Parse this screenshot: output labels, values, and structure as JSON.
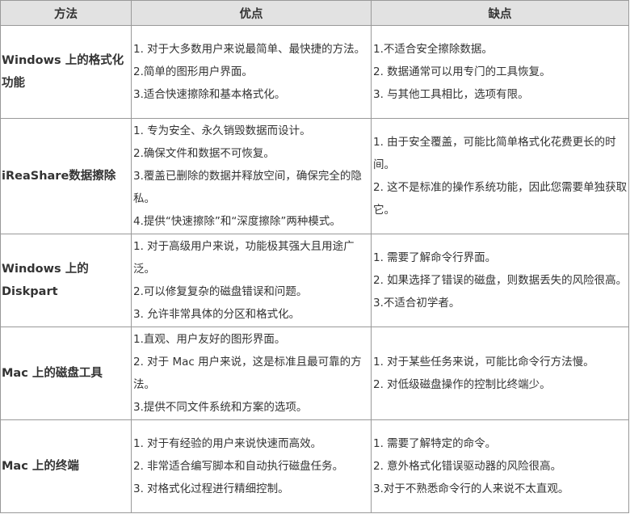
{
  "table": {
    "headers": {
      "method": "方法",
      "pros": "优点",
      "cons": "缺点"
    },
    "rows": [
      {
        "method": "Windows 上的格式化功能",
        "pros": [
          "1. 对于大多数用户来说最简单、最快捷的方法。",
          "2.简单的图形用户界面。",
          "3.适合快速擦除和基本格式化。"
        ],
        "cons": [
          "1.不适合安全擦除数据。",
          "2. 数据通常可以用专门的工具恢复。",
          "3. 与其他工具相比，选项有限。"
        ]
      },
      {
        "method": "iReaShare数据擦除",
        "pros": [
          "1. 专为安全、永久销毁数据而设计。",
          "2.确保文件和数据不可恢复。",
          "3.覆盖已删除的数据并释放空间，确保完全的隐私。",
          "4.提供“快速擦除”和“深度擦除”两种模式。"
        ],
        "cons": [
          "1. 由于安全覆盖，可能比简单格式化花费更长的时间。",
          "2. 这不是标准的操作系统功能，因此您需要单独获取它。"
        ]
      },
      {
        "method": "Windows 上的 Diskpart",
        "pros": [
          "1. 对于高级用户来说，功能极其强大且用途广泛。",
          "2.可以修复复杂的磁盘错误和问题。",
          "3. 允许非常具体的分区和格式化。"
        ],
        "cons": [
          "1. 需要了解命令行界面。",
          "2. 如果选择了错误的磁盘，则数据丢失的风险很高。",
          "3.不适合初学者。"
        ]
      },
      {
        "method": "Mac 上的磁盘工具",
        "pros": [
          "1.直观、用户友好的图形界面。",
          "2. 对于 Mac 用户来说，这是标准且最可靠的方法。",
          "3.提供不同文件系统和方案的选项。"
        ],
        "cons": [
          "1. 对于某些任务来说，可能比命令行方法慢。",
          "2. 对低级磁盘操作的控制比终端少。"
        ]
      },
      {
        "method": "Mac 上的终端",
        "pros": [
          "1. 对于有经验的用户来说快速而高效。",
          "2. 非常适合编写脚本和自动执行磁盘任务。",
          "3. 对格式化过程进行精细控制。"
        ],
        "cons": [
          "1. 需要了解特定的命令。",
          "2. 意外格式化错误驱动器的风险很高。",
          "3.对于不熟悉命令行的人来说不太直观。"
        ]
      }
    ]
  }
}
